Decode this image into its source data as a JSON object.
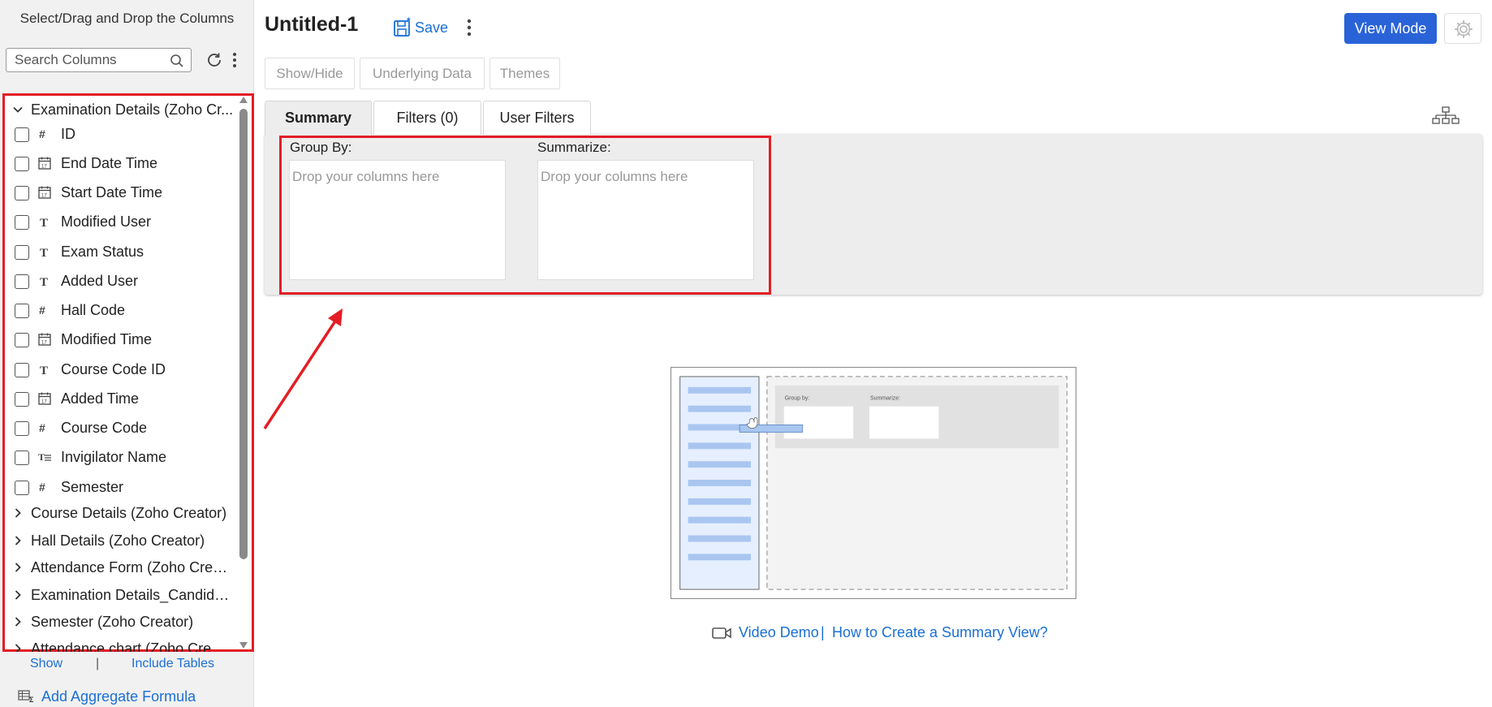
{
  "left_panel": {
    "title": "Select/Drag and Drop the Columns",
    "search_placeholder": "Search Columns",
    "groups_top": {
      "label": "Examination Details (Zoho Cr...",
      "expanded": true
    },
    "columns": [
      {
        "label": "ID",
        "type": "number"
      },
      {
        "label": "End Date Time",
        "type": "date"
      },
      {
        "label": "Start Date Time",
        "type": "date"
      },
      {
        "label": "Modified User",
        "type": "text"
      },
      {
        "label": "Exam Status",
        "type": "text"
      },
      {
        "label": "Added User",
        "type": "text"
      },
      {
        "label": "Hall Code",
        "type": "number"
      },
      {
        "label": "Modified Time",
        "type": "date"
      },
      {
        "label": "Course Code ID",
        "type": "text"
      },
      {
        "label": "Added Time",
        "type": "date"
      },
      {
        "label": "Course Code",
        "type": "number"
      },
      {
        "label": "Invigilator Name",
        "type": "multiline-text"
      },
      {
        "label": "Semester",
        "type": "number"
      }
    ],
    "groups": [
      "Course Details (Zoho Creator)",
      "Hall Details (Zoho Creator)",
      "Attendance Form (Zoho Creat...",
      "Examination Details_Candidat...",
      "Semester (Zoho Creator)",
      "Attendance chart (Zoho Creat..."
    ],
    "show_label": "Show",
    "pipe": "|",
    "include_tables_label": "Include Tables",
    "add_aggregate_label": "Add Aggregate Formula"
  },
  "header": {
    "title": "Untitled-1",
    "save_label": "Save",
    "view_mode_label": "View Mode"
  },
  "toolbar": {
    "show_hide": "Show/Hide",
    "underlying_data": "Underlying Data",
    "themes": "Themes"
  },
  "tabs": {
    "summary": "Summary",
    "filters": "Filters  (0)",
    "user_filters": "User Filters"
  },
  "drop_zones": {
    "group_by_label": "Group By:",
    "summarize_label": "Summarize:",
    "placeholder": "Drop your columns here"
  },
  "illustration": {
    "group_by": "Group by:",
    "summarize": "Summarize:"
  },
  "demo": {
    "video_label": "Video Demo",
    "pipe": "|",
    "howto_label": "How to Create a Summary View?"
  },
  "colors": {
    "accent": "#2a63d8",
    "link": "#1a6fd6",
    "highlight": "#e31e24"
  }
}
